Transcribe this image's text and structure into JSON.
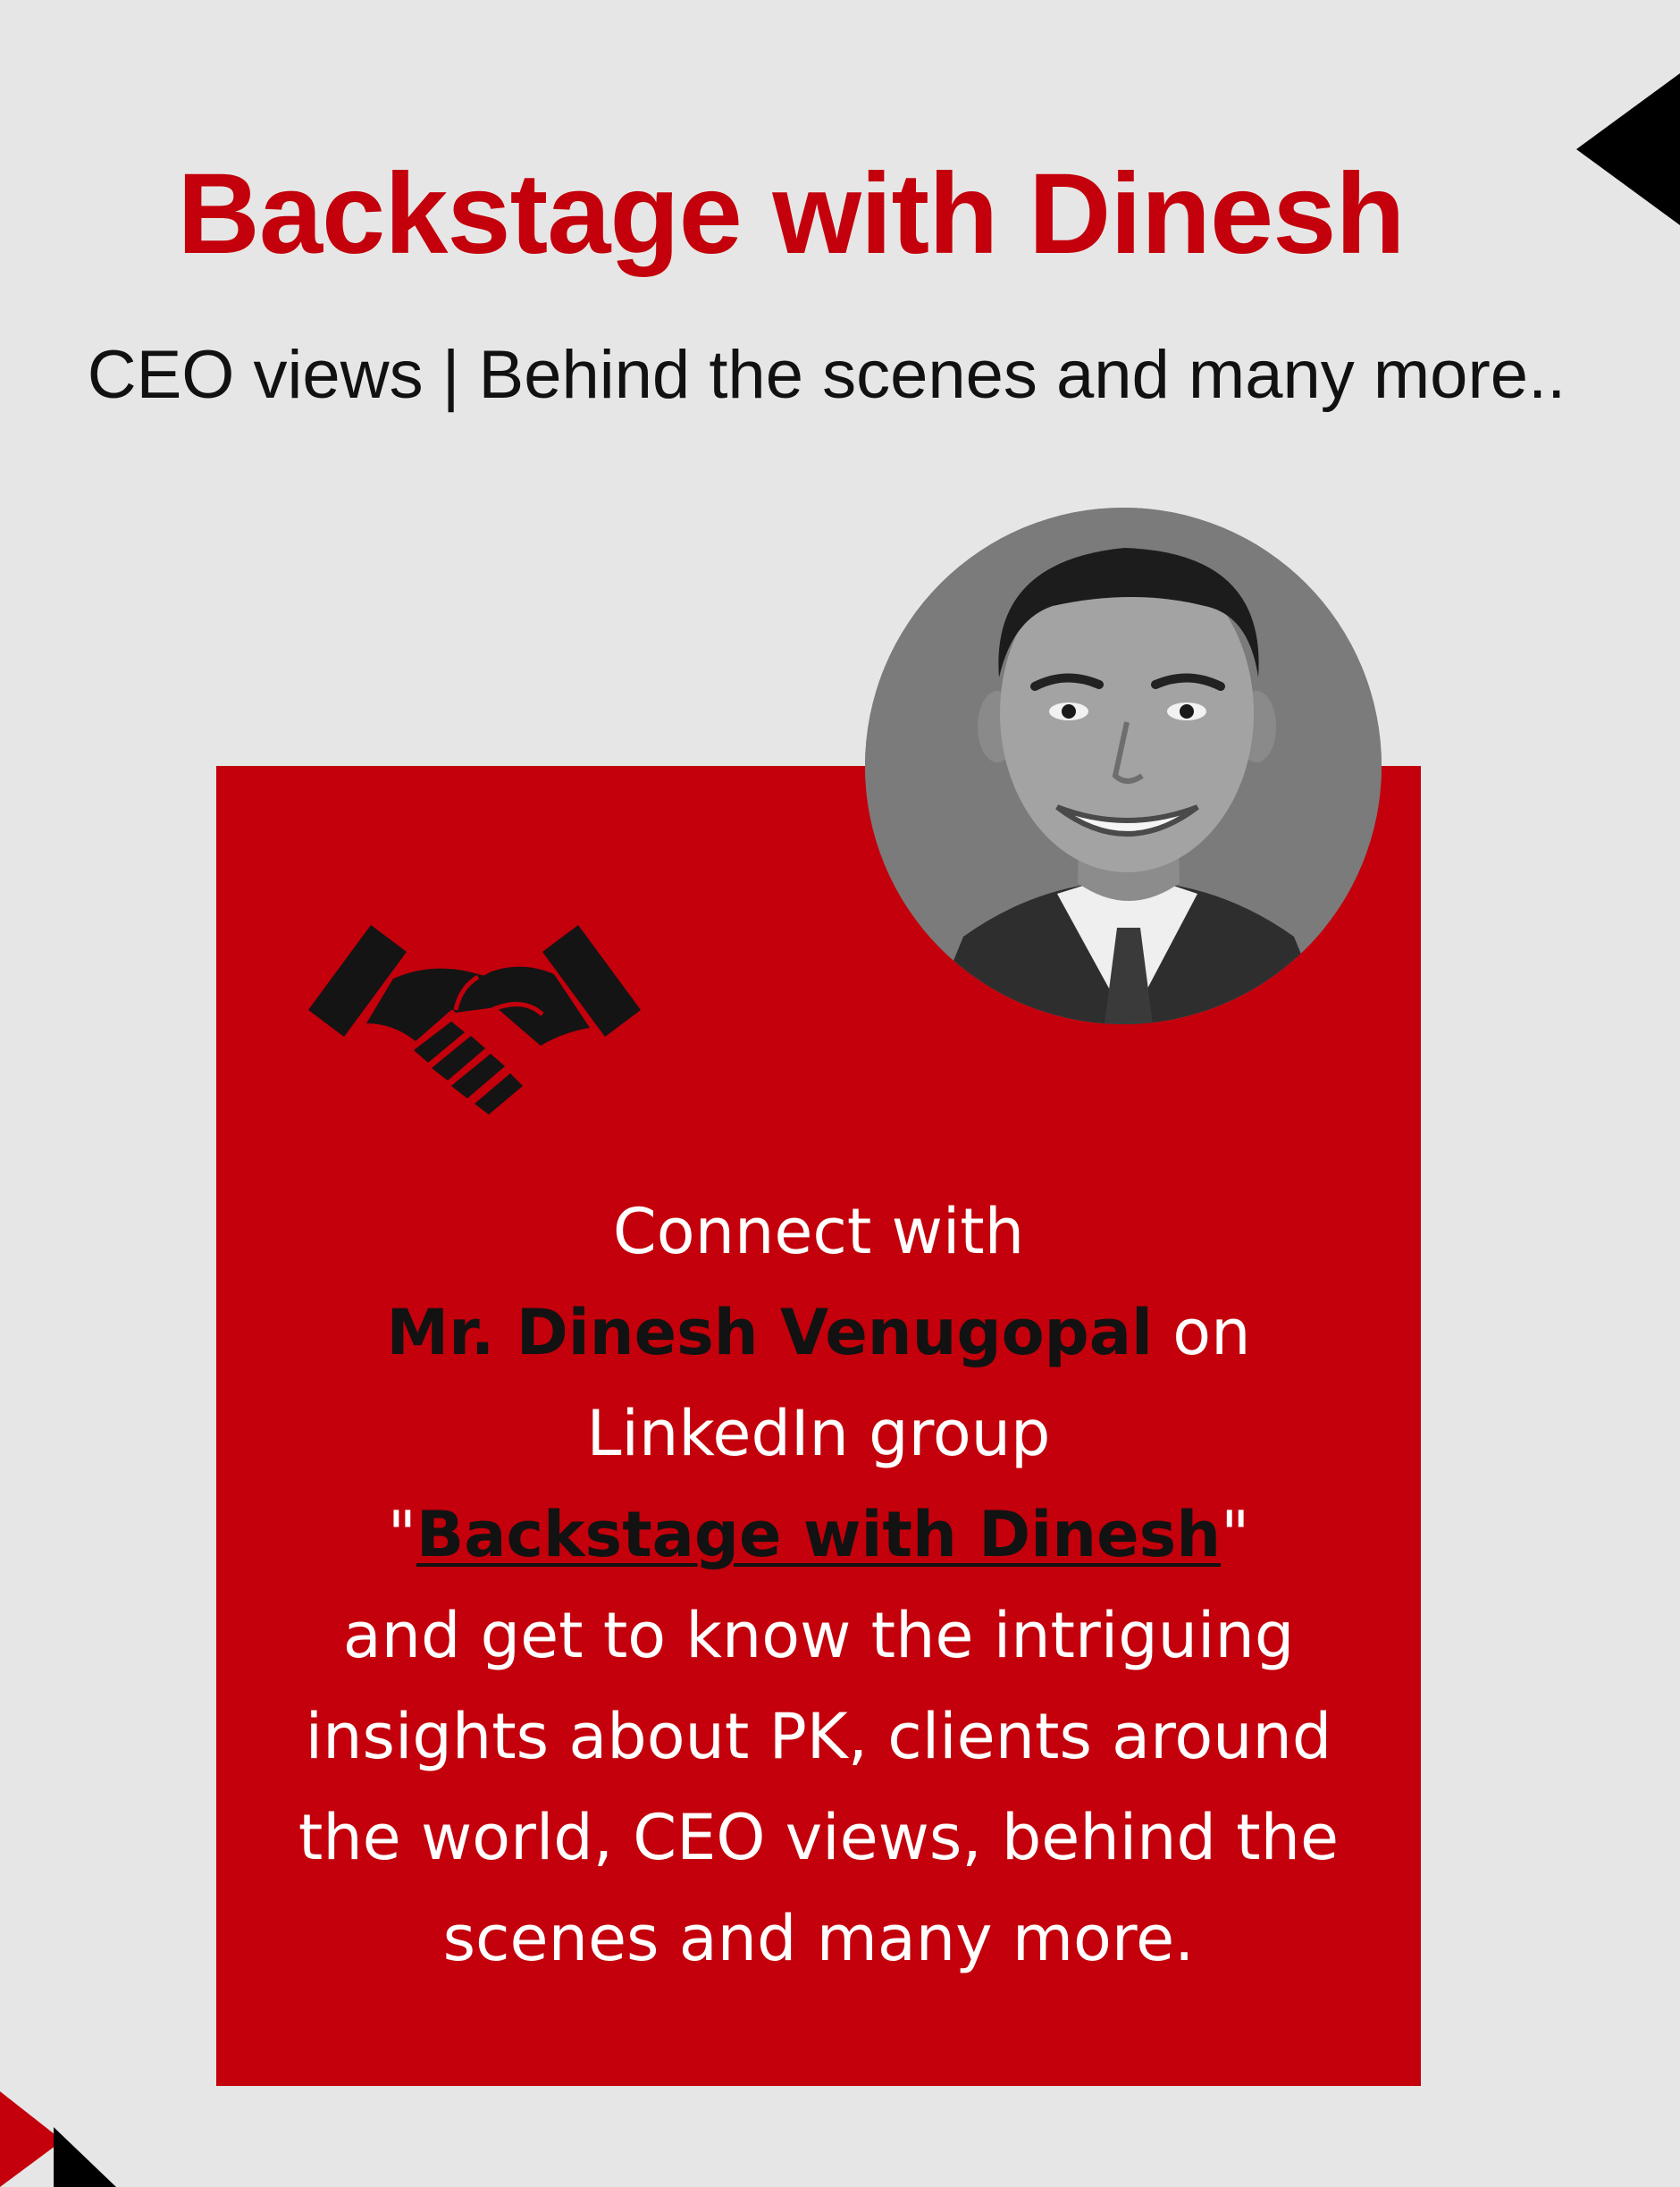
{
  "header": {
    "title": "Backstage with Dinesh",
    "subtitle": "CEO views | Behind the scenes and many more.."
  },
  "card": {
    "line1": "Connect with",
    "name": "Mr. Dinesh Venugopal",
    "name_suffix": " on",
    "line3": "LinkedIn group",
    "quote_open": "\"",
    "group_link": "Backstage with Dinesh",
    "quote_close": "\"",
    "line5": "and get to know the intriguing",
    "line6": "insights about PK, clients around",
    "line7": "the world, CEO views, behind the",
    "line8": "scenes and many more."
  },
  "colors": {
    "background": "#e6e6e6",
    "accent_red": "#c3000b",
    "dark": "#121212",
    "white": "#ffffff"
  },
  "icons": {
    "handshake": "handshake-icon",
    "portrait": "profile-photo"
  }
}
